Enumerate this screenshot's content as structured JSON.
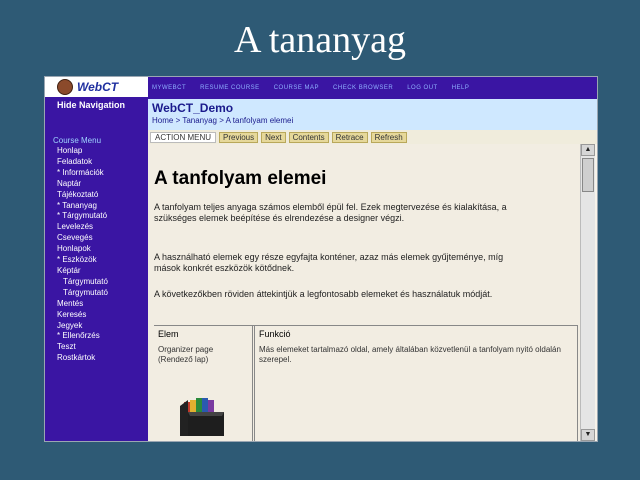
{
  "slide": {
    "title": "A tananyag"
  },
  "sidebar": {
    "logo": "WebCT",
    "hide_nav": "Hide Navigation",
    "menu_title": "Course Menu",
    "items": [
      {
        "label": "Honlap"
      },
      {
        "label": "Feladatok"
      },
      {
        "label": "* Információk"
      },
      {
        "label": "Naptár"
      },
      {
        "label": "Tájékoztató"
      },
      {
        "label": "* Tananyag"
      },
      {
        "label": "* Tárgymutató"
      },
      {
        "label": "Levelezés"
      },
      {
        "label": "Csevegés"
      },
      {
        "label": "Honlapok"
      },
      {
        "label": "* Eszközök"
      },
      {
        "label": "Képtár"
      },
      {
        "label": "Tárgymutató",
        "sub": true
      },
      {
        "label": "Tárgymutató",
        "sub": true
      },
      {
        "label": "Mentés"
      },
      {
        "label": "Keresés"
      },
      {
        "label": "Jegyek"
      },
      {
        "label": "* Ellenőrzés"
      },
      {
        "label": "Teszt"
      },
      {
        "label": "Rostkártok"
      }
    ]
  },
  "topnav": {
    "items": [
      "MYWEBCT",
      "RESUME COURSE",
      "COURSE MAP",
      "CHECK BROWSER",
      "LOG OUT",
      "HELP"
    ]
  },
  "header": {
    "course_title": "WebCT_Demo",
    "breadcrumb": "Home  >  Tananyag  >  A tanfolyam elemei"
  },
  "action_bar": {
    "label": "ACTION MENU",
    "buttons": [
      "Previous",
      "Next",
      "Contents",
      "Retrace",
      "Refresh"
    ]
  },
  "content": {
    "heading": "A tanfolyam elemei",
    "p1": "A tanfolyam teljes anyaga számos elemből épül fel. Ezek megtervezése és kialakítása, a szükséges elemek beépítése és elrendezése a designer végzi.",
    "p2": "A használható elemek egy része egyfajta konténer, azaz más elemek gyűjteménye, míg mások konkrét eszközök kötődnek.",
    "p3": "A következőkben röviden áttekintjük a legfontosabb elemeket és használatuk módját.",
    "table": {
      "col1_header": "Elem",
      "col2_header": "Funkció",
      "row1_elem": "Organizer page (Rendező lap)",
      "row1_func": "Más elemeket tartalmazó oldal, amely általában közvetlenül a tanfolyam nyitó oldalán szerepel."
    }
  },
  "scrollbar": {
    "up": "▲",
    "down": "▼"
  }
}
